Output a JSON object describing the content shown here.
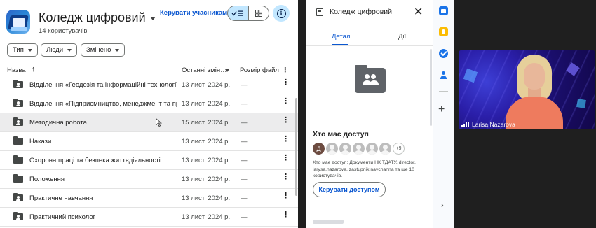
{
  "drive": {
    "title": "Коледж цифровий",
    "users_count": "14 користувачів",
    "manage_members": "Керувати учасниками"
  },
  "filters": [
    {
      "label": "Тип"
    },
    {
      "label": "Люди"
    },
    {
      "label": "Змінено"
    }
  ],
  "table": {
    "columns": {
      "name": "Назва",
      "sort_arrow": "↑",
      "modified": "Останні змін…",
      "size": "Розмір файл"
    },
    "rows": [
      {
        "name": "Відділення «Геодезія та інформаційні технології»",
        "modified": "13 лист. 2024 р.",
        "size": "—",
        "shared": true
      },
      {
        "name": "Відділення «Підприємництво, менеджмент та право»",
        "modified": "13 лист. 2024 р.",
        "size": "—",
        "shared": true
      },
      {
        "name": "Методична робота",
        "modified": "15 лист. 2024 р.",
        "size": "—",
        "shared": true
      },
      {
        "name": "Накази",
        "modified": "13 лист. 2024 р.",
        "size": "—",
        "shared": false
      },
      {
        "name": "Охорона праці та безпека життєдіяльності",
        "modified": "13 лист. 2024 р.",
        "size": "—",
        "shared": false
      },
      {
        "name": "Положення",
        "modified": "13 лист. 2024 р.",
        "size": "—",
        "shared": false
      },
      {
        "name": "Практичне навчання",
        "modified": "13 лист. 2024 р.",
        "size": "—",
        "shared": true
      },
      {
        "name": "Практичний психолог",
        "modified": "13 лист. 2024 р.",
        "size": "—",
        "shared": true
      }
    ]
  },
  "details": {
    "title": "Коледж цифровий",
    "tabs": {
      "details": "Деталі",
      "actions": "Дії"
    },
    "access_title": "Хто має доступ",
    "avatar_letter": "Д",
    "more_count": "+9",
    "access_description": "Хто має доступ: Документи НК ТДАТУ, director, larysa.nazarova, zastupnik.navchanna та ще 10 користувачів.",
    "manage_access": "Керувати доступом"
  },
  "video": {
    "participant": "Larisa Nazarova"
  },
  "colors": {
    "accent": "#0b57d0",
    "toggle_active": "#c2e7ff",
    "hover_row": "#ececed",
    "shirt": "#ee7b5e"
  }
}
